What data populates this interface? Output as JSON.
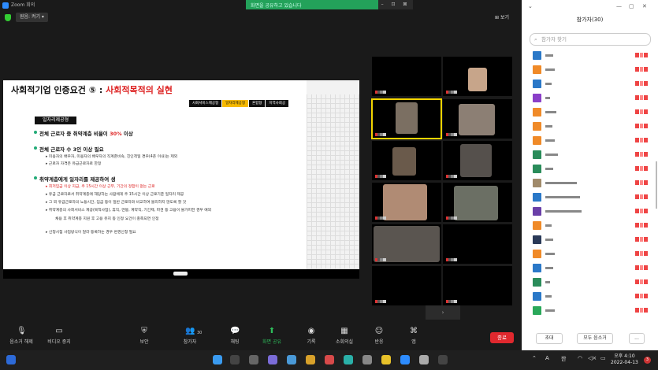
{
  "window": {
    "title": "Zoom 회의"
  },
  "share_banner": {
    "text": "화면을 공유하고 있습니다",
    "controls": "– ⊡ ⊠"
  },
  "top_controls": {
    "view_label": "원음: 켜기",
    "gallery_view": "보기"
  },
  "slide": {
    "title_plain": "사회적기업 인증요건 ⑤ : ",
    "title_red": "사회적목적의 실현",
    "tabs": [
      "사회서비스제공형",
      "일자리제공형",
      "혼합형",
      "지역사회공"
    ],
    "section_tag": "일자리제공형",
    "bullets": [
      {
        "prefix": "전체 근로자 중 취약계층 비율이 ",
        "highlight": "30%",
        "suffix": " 이상"
      },
      {
        "text": "전체 근로자 수 3인 이상 필요"
      },
      {
        "text": "취약계층에게 일자리를 제공하여 생"
      }
    ],
    "sub_items": [
      "▸ 미용자의 배우자, 미용자의 배우자의 직계존비속, 친인척일 경우(4촌 이내)는 제외",
      "▸ 근로자 자격은 유급근로자로 한정",
      "▸ 최저임금 이상 지급, 주 15시간 이상 근무, 기간의 정함이 없는 근로",
      "▸ 유급 근로자로서 취약계층에 해당하는 사람에게 주 15시간 이상 근로기준 일자리 제공",
      "▸ 그 외 유급근로자의 노동시간, 임금 등이 일반 근로자와 비교하여 불리하지 않도록 할 것",
      "▸ 취약계층의 사회서비스 제공(목적사업), 휴직, 연봉, 계약직, 기간제, 파견 등 고용이 불가피한 경우 예외",
      "채용 후 취약계층 지원 후 고용 유지 등 인정 요건이 충족되면 인정",
      "▸ 신청시점 사업방식이 달라 등록하는 경우 변경신청 필요"
    ]
  },
  "toolbar": {
    "items": [
      {
        "label": "음소거 해제",
        "icon": "mic-muted-icon"
      },
      {
        "label": "비디오 중지",
        "icon": "video-icon"
      },
      {
        "label": "보안",
        "icon": "shield-icon"
      },
      {
        "label": "참가자",
        "icon": "participants-icon",
        "count": "30"
      },
      {
        "label": "채팅",
        "icon": "chat-icon"
      },
      {
        "label": "화면 공유",
        "icon": "share-screen-icon"
      },
      {
        "label": "기록",
        "icon": "record-icon"
      },
      {
        "label": "소회의실",
        "icon": "breakout-icon"
      },
      {
        "label": "반응",
        "icon": "reaction-icon"
      },
      {
        "label": "앱",
        "icon": "apps-icon"
      }
    ],
    "end_label": "종료"
  },
  "panel": {
    "title": "참가자(30)",
    "search_placeholder": "참가자 찾기",
    "invite_label": "초대",
    "mute_all_label": "모두 음소거",
    "more_label": "..."
  },
  "taskbar": {
    "lang": "A",
    "ime": "한",
    "time": "오후 4:10",
    "date": "2022-04-13",
    "notif_count": "3"
  },
  "colors": {
    "accent_green": "#2ebd5b",
    "end_red": "#e0282e",
    "active_speaker": "#f2d400",
    "slide_red": "#d22222"
  }
}
